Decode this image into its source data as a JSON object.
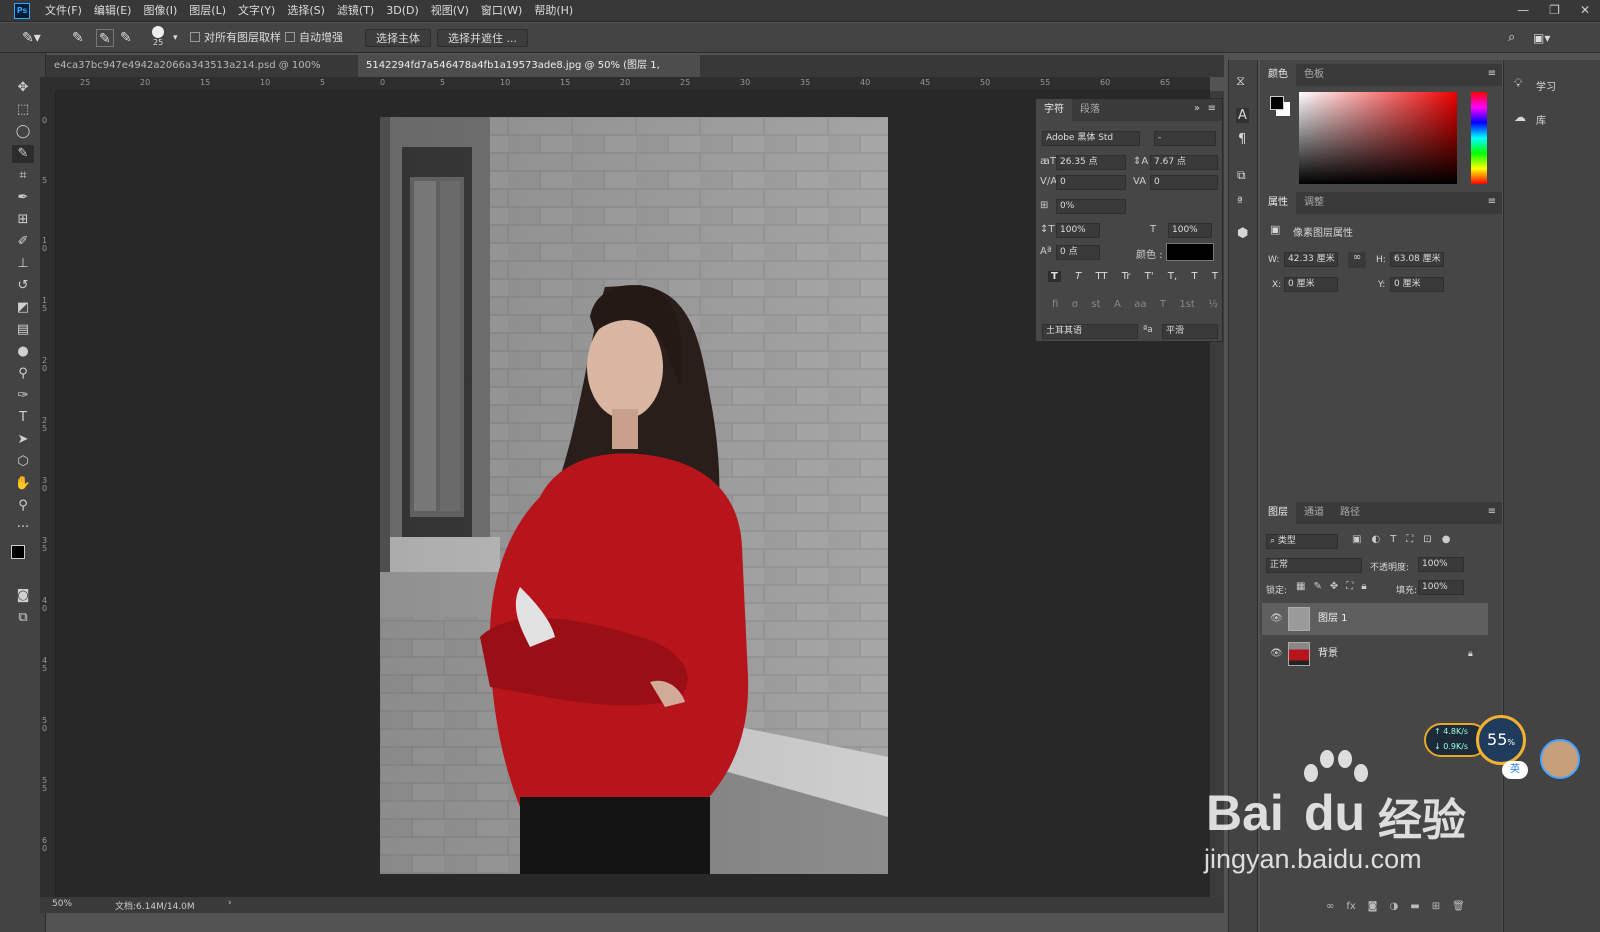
{
  "app": {
    "logo": "Ps"
  },
  "menu": [
    "文件(F)",
    "编辑(E)",
    "图像(I)",
    "图层(L)",
    "文字(Y)",
    "选择(S)",
    "滤镜(T)",
    "3D(D)",
    "视图(V)",
    "窗口(W)",
    "帮助(H)"
  ],
  "window_controls": [
    "—",
    "❐",
    "✕"
  ],
  "options": {
    "brush_size": "25",
    "sample_all_layers": "对所有图层取样",
    "auto_enhance": "自动增强",
    "select_subject": "选择主体",
    "select_and_mask": "选择并遮住 ..."
  },
  "tabs": [
    {
      "label": "e4ca37bc947e4942a2066a343513a214.psd @ 100%(RGB/8#)",
      "close": "×"
    },
    {
      "label": "5142294fd7a546478a4fb1a19573ade8.jpg @ 50% (图层 1, RGB/8#) *",
      "close": "×"
    }
  ],
  "ruler_top": [
    "25",
    "20",
    "15",
    "10",
    "5",
    "0",
    "5",
    "10",
    "15",
    "20",
    "25",
    "30",
    "35",
    "40",
    "45",
    "50",
    "55",
    "60",
    "65"
  ],
  "ruler_left": [
    "0",
    "5",
    "1\n0",
    "1\n5",
    "2\n0",
    "2\n5",
    "3\n0",
    "3\n5",
    "4\n0",
    "4\n5",
    "5\n0",
    "5\n5",
    "6\n0",
    "6\n5"
  ],
  "status": {
    "zoom": "50%",
    "doc": "文档:6.14M/14.0M",
    "arrow": "›"
  },
  "character": {
    "tab1": "字符",
    "tab2": "段落",
    "font": "Adobe 黑体 Std",
    "style": "-",
    "size": "26.35 点",
    "leading": "7.67 点",
    "kerning": "0",
    "tracking": "0",
    "scale_pct": "0%",
    "vscale": "100%",
    "hscale": "100%",
    "baseline": "0 点",
    "color_label": "颜色 :",
    "styles": [
      "T",
      "T",
      "TT",
      "Tr",
      "T'",
      "T,",
      "T",
      "T"
    ],
    "opentype": [
      "fi",
      "σ",
      "st",
      "A",
      "aa",
      "T",
      "1st",
      "½"
    ],
    "language": "土耳其语",
    "aa_label": "ªa",
    "antialias": "平滑"
  },
  "color_panel": {
    "tab1": "颜色",
    "tab2": "色板"
  },
  "properties": {
    "tab1": "属性",
    "tab2": "调整",
    "title": "像素图层属性",
    "w_label": "W:",
    "w": "42.33 厘米",
    "h_label": "H:",
    "h": "63.08 厘米",
    "x_label": "X:",
    "x": "0 厘米",
    "y_label": "Y:",
    "y": "0 厘米"
  },
  "layers": {
    "tab1": "图层",
    "tab2": "通道",
    "tab3": "路径",
    "filter": "类型",
    "blend": "正常",
    "opacity_label": "不透明度:",
    "opacity": "100%",
    "lock_label": "锁定:",
    "fill_label": "填充:",
    "fill": "100%",
    "items": [
      {
        "name": "图层 1",
        "selected": true
      },
      {
        "name": "背景",
        "locked": true
      }
    ],
    "bottom_icons": [
      "link-icon",
      "fx-icon",
      "mask-icon",
      "adjust-icon",
      "folder-icon",
      "new-layer-icon",
      "trash-icon"
    ],
    "fx": "fx"
  },
  "far_right": {
    "learn": "学习",
    "library": "库"
  },
  "net_widget": {
    "up": "4.8K/s",
    "down": "0.9K/s",
    "percent": "55",
    "unit": "%",
    "ime": "英"
  },
  "watermark": {
    "brand": "Bai",
    "brand2": "du",
    "suffix": "经验",
    "url": "jingyan.baidu.com"
  },
  "colors": {
    "accent": "#31a8ff",
    "sweater": "#b8141c",
    "selected_layer": "#5f5f5f"
  }
}
